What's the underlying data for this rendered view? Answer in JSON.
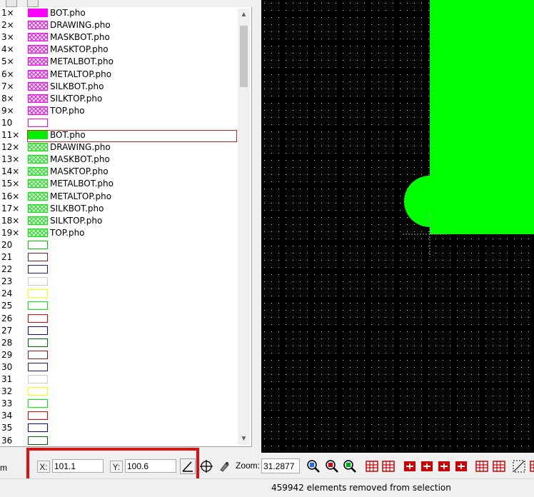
{
  "layers": [
    {
      "num": "1×",
      "name": "BOT.pho",
      "swatch": "solid",
      "color": "#ff00ff"
    },
    {
      "num": "2×",
      "name": "DRAWING.pho",
      "swatch": "hatch",
      "color": "#ff00ff"
    },
    {
      "num": "3×",
      "name": "MASKBOT.pho",
      "swatch": "hatch",
      "color": "#ff00ff"
    },
    {
      "num": "4×",
      "name": "MASKTOP.pho",
      "swatch": "hatch",
      "color": "#ff00ff"
    },
    {
      "num": "5×",
      "name": "METALBOT.pho",
      "swatch": "hatch",
      "color": "#ff00ff"
    },
    {
      "num": "6×",
      "name": "METALTOP.pho",
      "swatch": "hatch",
      "color": "#ff00ff"
    },
    {
      "num": "7×",
      "name": "SILKBOT.pho",
      "swatch": "hatch",
      "color": "#ff00ff"
    },
    {
      "num": "8×",
      "name": "SILKTOP.pho",
      "swatch": "hatch",
      "color": "#ff00ff"
    },
    {
      "num": "9×",
      "name": "TOP.pho",
      "swatch": "hatch",
      "color": "#ff00ff"
    },
    {
      "num": "10",
      "name": "",
      "swatch": "outline",
      "color": "#ff00ff"
    },
    {
      "num": "11×",
      "name": "BOT.pho",
      "swatch": "solid",
      "color": "#00ee00",
      "selected": true
    },
    {
      "num": "12×",
      "name": "DRAWING.pho",
      "swatch": "hatch",
      "color": "#00ee00"
    },
    {
      "num": "13×",
      "name": "MASKBOT.pho",
      "swatch": "hatch",
      "color": "#00ee00"
    },
    {
      "num": "14×",
      "name": "MASKTOP.pho",
      "swatch": "hatch",
      "color": "#00ee00"
    },
    {
      "num": "15×",
      "name": "METALBOT.pho",
      "swatch": "hatch",
      "color": "#00ee00"
    },
    {
      "num": "16×",
      "name": "METALTOP.pho",
      "swatch": "hatch",
      "color": "#00ee00"
    },
    {
      "num": "17×",
      "name": "SILKBOT.pho",
      "swatch": "hatch",
      "color": "#00ee00"
    },
    {
      "num": "18×",
      "name": "SILKTOP.pho",
      "swatch": "hatch",
      "color": "#00ee00"
    },
    {
      "num": "19×",
      "name": "TOP.pho",
      "swatch": "hatch",
      "color": "#00ee00"
    },
    {
      "num": "20",
      "name": "",
      "swatch": "outline",
      "color": "#00cc00"
    },
    {
      "num": "21",
      "name": "",
      "swatch": "outline",
      "color": "#8b1a1a"
    },
    {
      "num": "22",
      "name": "",
      "swatch": "outline",
      "color": "#1a1a8b"
    },
    {
      "num": "23",
      "name": "",
      "swatch": "outline",
      "color": "#cccccc"
    },
    {
      "num": "24",
      "name": "",
      "swatch": "outline",
      "color": "#ffff00"
    },
    {
      "num": "25",
      "name": "",
      "swatch": "outline",
      "color": "#00ee00"
    },
    {
      "num": "26",
      "name": "",
      "swatch": "outline",
      "color": "#ee0000"
    },
    {
      "num": "27",
      "name": "",
      "swatch": "outline",
      "color": "#0000cc"
    },
    {
      "num": "28",
      "name": "",
      "swatch": "outline",
      "color": "#006600"
    },
    {
      "num": "29",
      "name": "",
      "swatch": "outline",
      "color": "#8b1a1a"
    },
    {
      "num": "30",
      "name": "",
      "swatch": "outline",
      "color": "#1a1a8b"
    },
    {
      "num": "31",
      "name": "",
      "swatch": "outline",
      "color": "#cccccc"
    },
    {
      "num": "32",
      "name": "",
      "swatch": "outline",
      "color": "#ffff00"
    },
    {
      "num": "33",
      "name": "",
      "swatch": "outline",
      "color": "#00ee00"
    },
    {
      "num": "34",
      "name": "",
      "swatch": "outline",
      "color": "#ee0000"
    },
    {
      "num": "35",
      "name": "",
      "swatch": "outline",
      "color": "#0000cc"
    },
    {
      "num": "36",
      "name": "",
      "swatch": "outline",
      "color": "#006600"
    }
  ],
  "coords": {
    "x_label": "X:",
    "x_value": "101.1",
    "y_label": "Y:",
    "y_value": "100.6"
  },
  "zoom": {
    "label": "Zoom:",
    "value": "31.2877"
  },
  "unit_text": "m",
  "status": "459942 elements removed from selection",
  "canvas": {
    "background": "#000000",
    "grid_dot_color": "#d8d8d8",
    "shape_color": "#00ff00"
  }
}
